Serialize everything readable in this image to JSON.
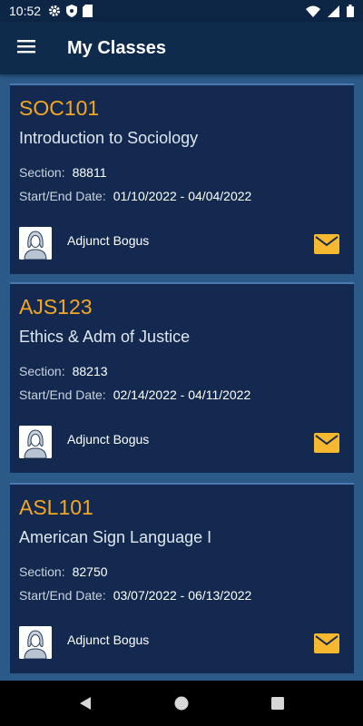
{
  "status_bar": {
    "time": "10:52",
    "icons": [
      "gear-icon",
      "shield-icon",
      "sd-card-icon",
      "wifi-icon",
      "signal-icon",
      "battery-icon"
    ]
  },
  "app_bar": {
    "title": "My Classes",
    "menu_icon": "hamburger-menu-icon"
  },
  "labels": {
    "section": "Section:",
    "dates": "Start/End Date:"
  },
  "classes": [
    {
      "code": "SOC101",
      "name": "Introduction to Sociology",
      "section": "88811",
      "dates": "01/10/2022 - 04/04/2022",
      "instructor": "Adjunct  Bogus"
    },
    {
      "code": "AJS123",
      "name": "Ethics & Adm of Justice",
      "section": "88213",
      "dates": "02/14/2022 - 04/11/2022",
      "instructor": "Adjunct  Bogus"
    },
    {
      "code": "ASL101",
      "name": "American Sign Language I",
      "section": "82750",
      "dates": "03/07/2022 - 06/13/2022",
      "instructor": "Adjunct  Bogus"
    }
  ],
  "colors": {
    "background": "#2b5a88",
    "card": "#13294f",
    "accent": "#f5a623",
    "app_bar": "#0f2b4c"
  },
  "nav_bar": {
    "icons": [
      "back-icon",
      "home-icon",
      "recents-icon"
    ]
  }
}
